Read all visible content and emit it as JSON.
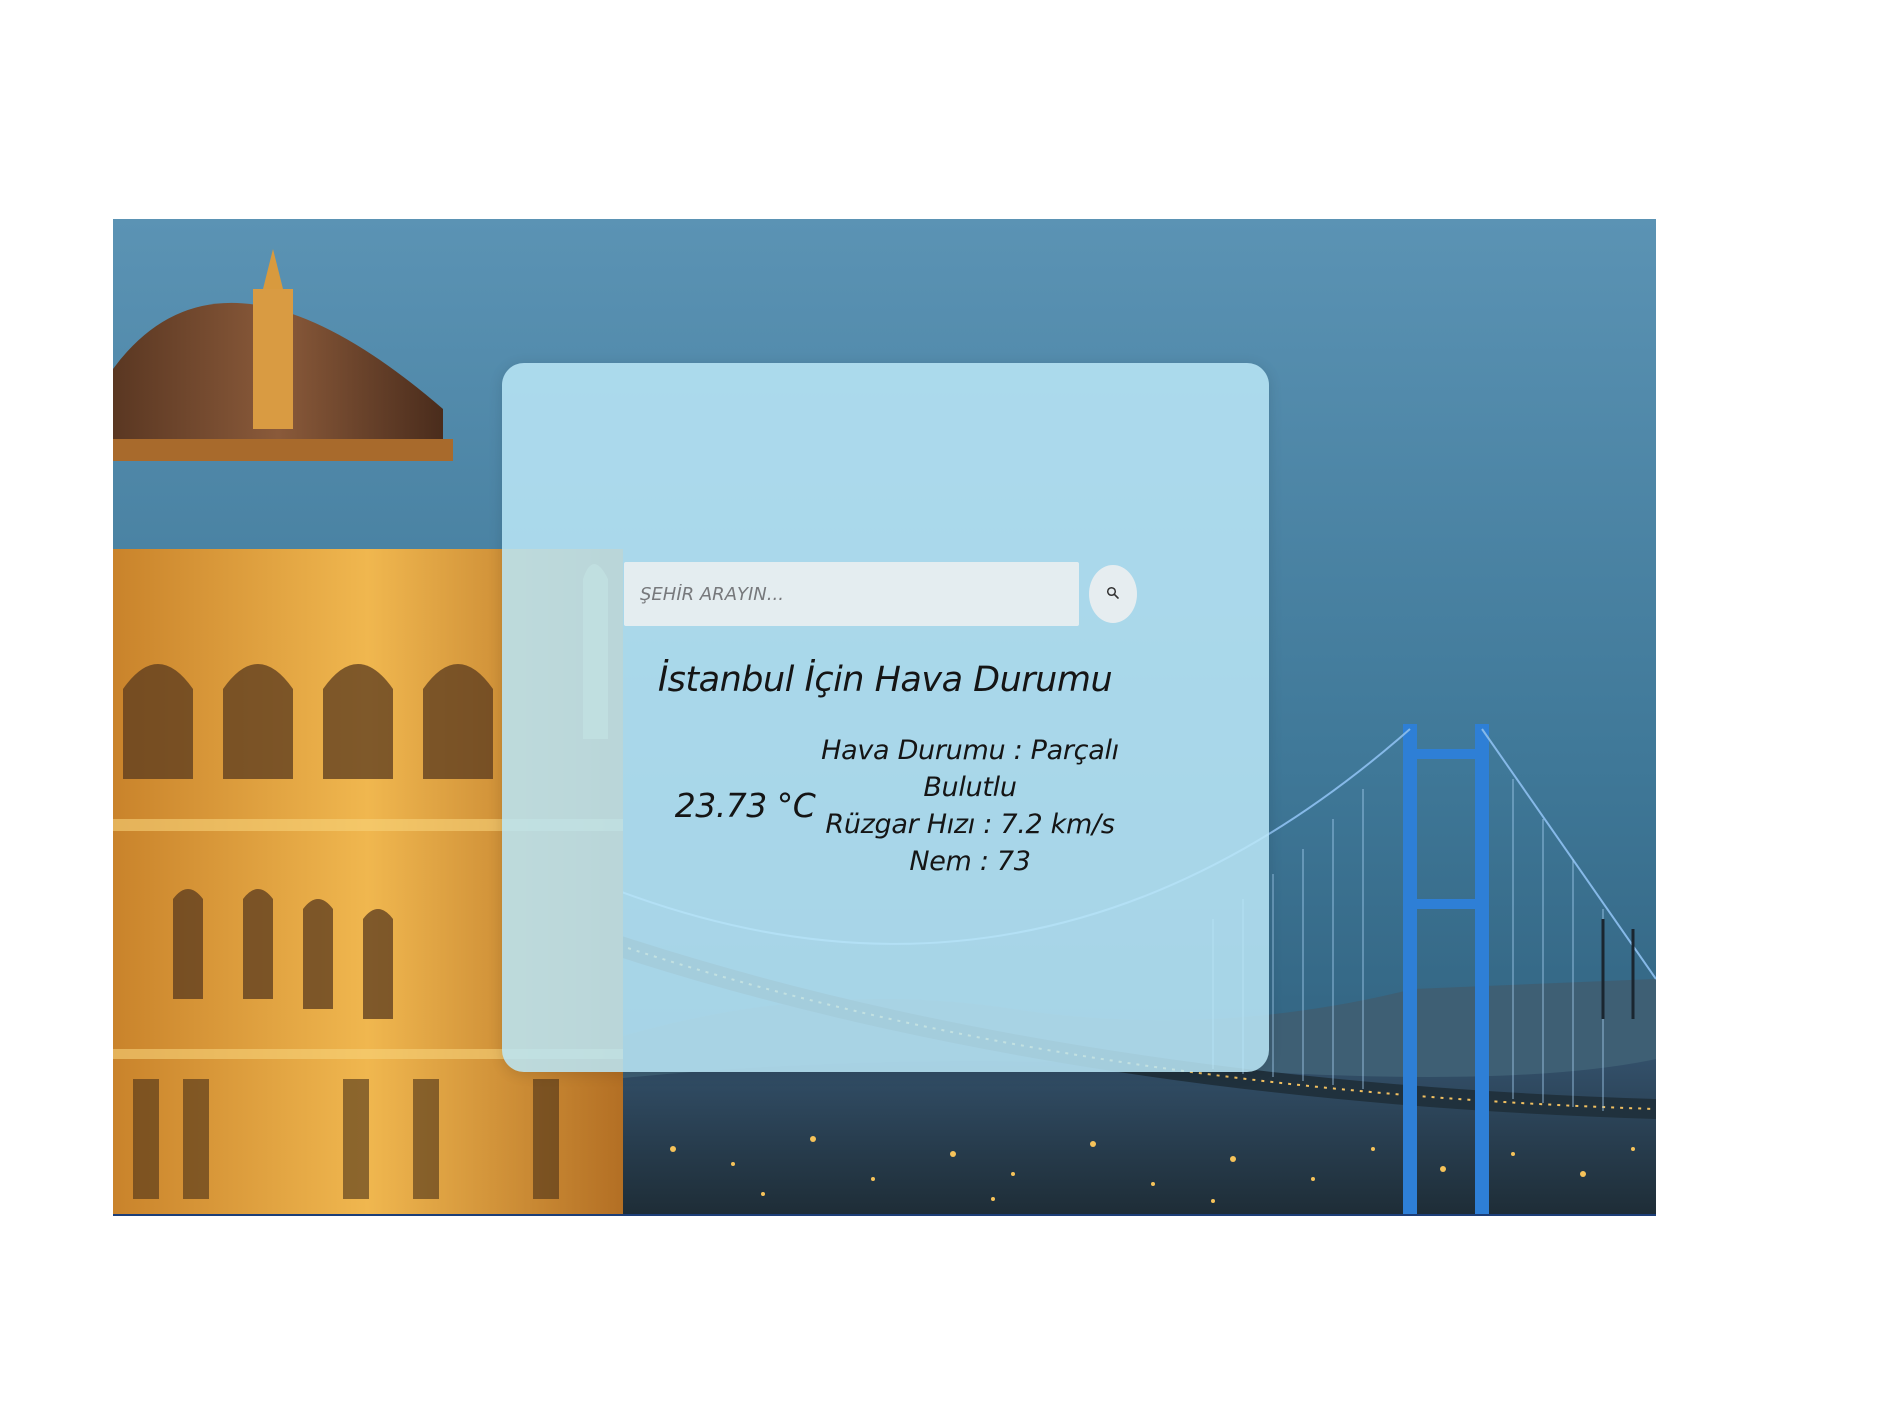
{
  "search": {
    "placeholder": "ŞEHİR ARAYIN...",
    "value": ""
  },
  "weather": {
    "title": "İstanbul İçin Hava Durumu",
    "temperature": "23.73 °C",
    "condition": "Hava Durumu : Parçalı Bulutlu",
    "wind": "Rüzgar Hızı : 7.2 km/s",
    "humidity": "Nem : 73"
  },
  "icons": {
    "search_button": "search-icon"
  },
  "colors": {
    "card": "#bae6f7",
    "text": "#151515",
    "input": "#e4edf0",
    "sky": "#3a6f8e",
    "mosque_gold": "#e0a43c",
    "bridge_blue": "#2e7fd6"
  }
}
